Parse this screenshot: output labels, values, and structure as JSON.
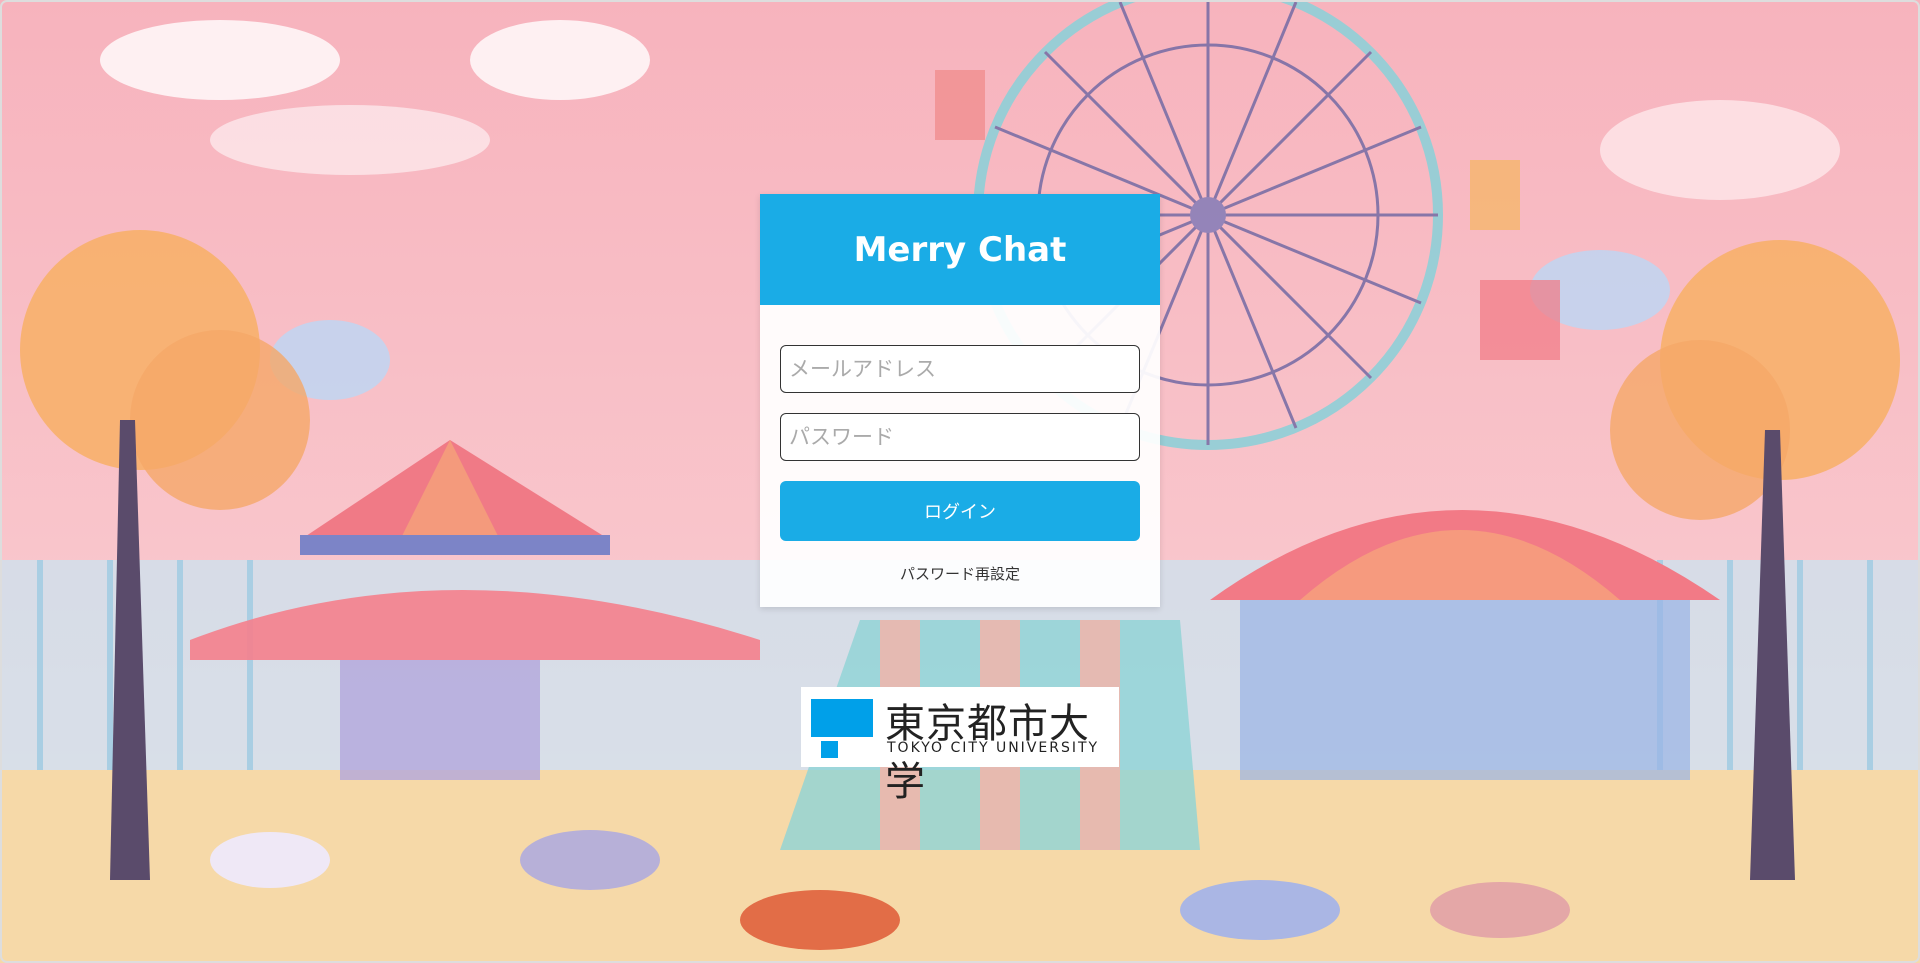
{
  "app": {
    "title": "Merry Chat"
  },
  "login": {
    "email_placeholder": "メールアドレス",
    "password_placeholder": "パスワード",
    "submit_label": "ログイン",
    "reset_link": "パスワード再設定"
  },
  "logo": {
    "name_jp": "東京都市大学",
    "name_en": "TOKYO CITY UNIVERSITY"
  },
  "colors": {
    "accent": "#1aace6",
    "logo_blue": "#00a0e9",
    "background_sky": "#f8bcc4"
  }
}
